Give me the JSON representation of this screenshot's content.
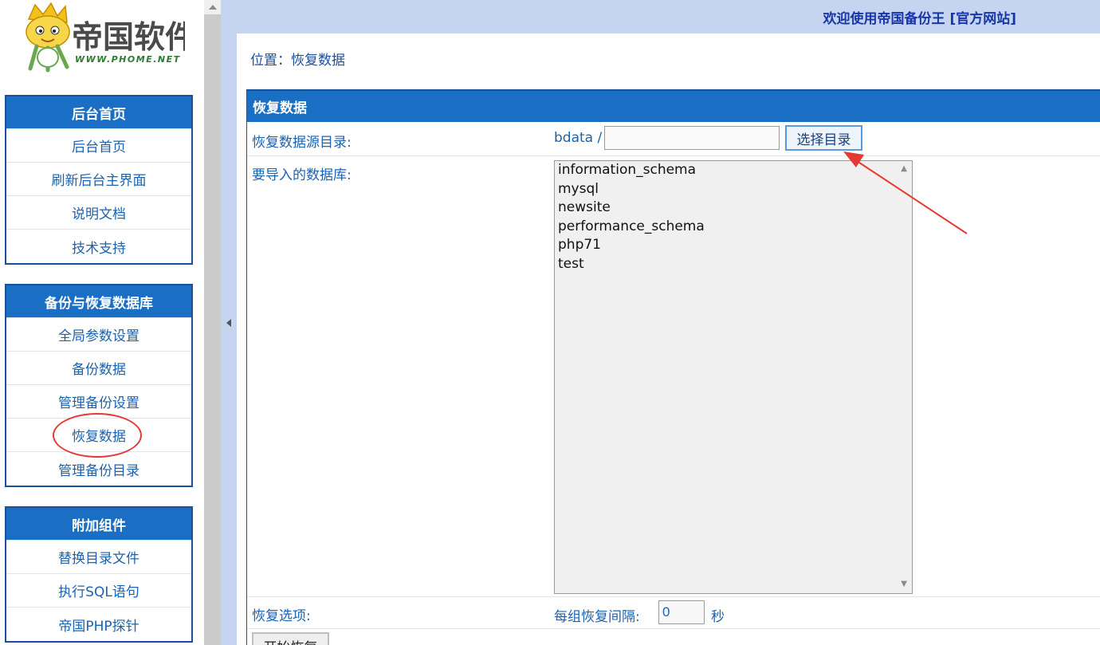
{
  "logo": {
    "title": "帝国软件",
    "url": "WWW.PHOME.NET"
  },
  "sidebar": {
    "groups": [
      {
        "title": "后台首页",
        "items": [
          "后台首页",
          "刷新后台主界面",
          "说明文档",
          "技术支持"
        ]
      },
      {
        "title": "备份与恢复数据库",
        "items": [
          "全局参数设置",
          "备份数据",
          "管理备份设置",
          "恢复数据",
          "管理备份目录"
        ]
      },
      {
        "title": "附加组件",
        "items": [
          "替换目录文件",
          "执行SQL语句",
          "帝国PHP探针"
        ]
      }
    ]
  },
  "header": {
    "welcome": "欢迎使用帝国备份王 [官方网站]"
  },
  "breadcrumb": "位置：恢复数据",
  "panel": {
    "title": "恢复数据",
    "source_dir_label": "恢复数据源目录:",
    "dir_prefix": "bdata /",
    "dir_value": "",
    "choose_dir_button": "选择目录",
    "db_label": "要导入的数据库:",
    "databases": [
      "information_schema",
      "mysql",
      "newsite",
      "performance_schema",
      "php71",
      "test"
    ],
    "options_label": "恢复选项:",
    "interval_label": "每组恢复间隔:",
    "interval_value": "0",
    "interval_unit": "秒",
    "start_button": "开始恢复"
  },
  "colors": {
    "accent": "#1a6fc4",
    "frame": "#c5d4ef",
    "annotation": "#e53935"
  }
}
